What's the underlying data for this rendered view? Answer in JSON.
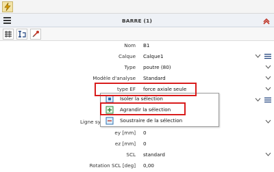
{
  "panel": {
    "title": "BARRE (1)"
  },
  "properties": [
    {
      "label": "Nom",
      "value": "B1",
      "control": "none"
    },
    {
      "label": "Calque",
      "value": "Calque1",
      "control": "dropdown-list"
    },
    {
      "label": "Type",
      "value": "poutre (80)",
      "control": "dropdown"
    },
    {
      "label": "Modèle d'analyse",
      "value": "Standard",
      "control": "dropdown"
    },
    {
      "label": "type EF",
      "value": "force axiale seule",
      "control": "dropdown"
    },
    {
      "label": "",
      "value": "",
      "control": "dropdown-list"
    },
    {
      "label": "",
      "value": "",
      "control": "none"
    },
    {
      "label": "Ligne syst",
      "value": "",
      "control": "dropdown"
    },
    {
      "label": "ey [mm]",
      "value": "0",
      "control": "none"
    },
    {
      "label": "ez [mm]",
      "value": "0",
      "control": "none"
    },
    {
      "label": "SCL",
      "value": "standard",
      "control": "dropdown"
    },
    {
      "label": "Rotation SCL [deg]",
      "value": "0,00",
      "control": "none"
    }
  ],
  "context_menu": {
    "items": [
      {
        "label": "Isoler la sélection",
        "icon": "isolate-selection-icon"
      },
      {
        "label": "Agrandir la sélection",
        "icon": "zoom-selection-icon"
      },
      {
        "label": "Soustraire de la sélection",
        "icon": "subtract-selection-icon"
      }
    ]
  },
  "colors": {
    "highlight": "#d81b1b",
    "header_bg": "#eef1f6"
  }
}
